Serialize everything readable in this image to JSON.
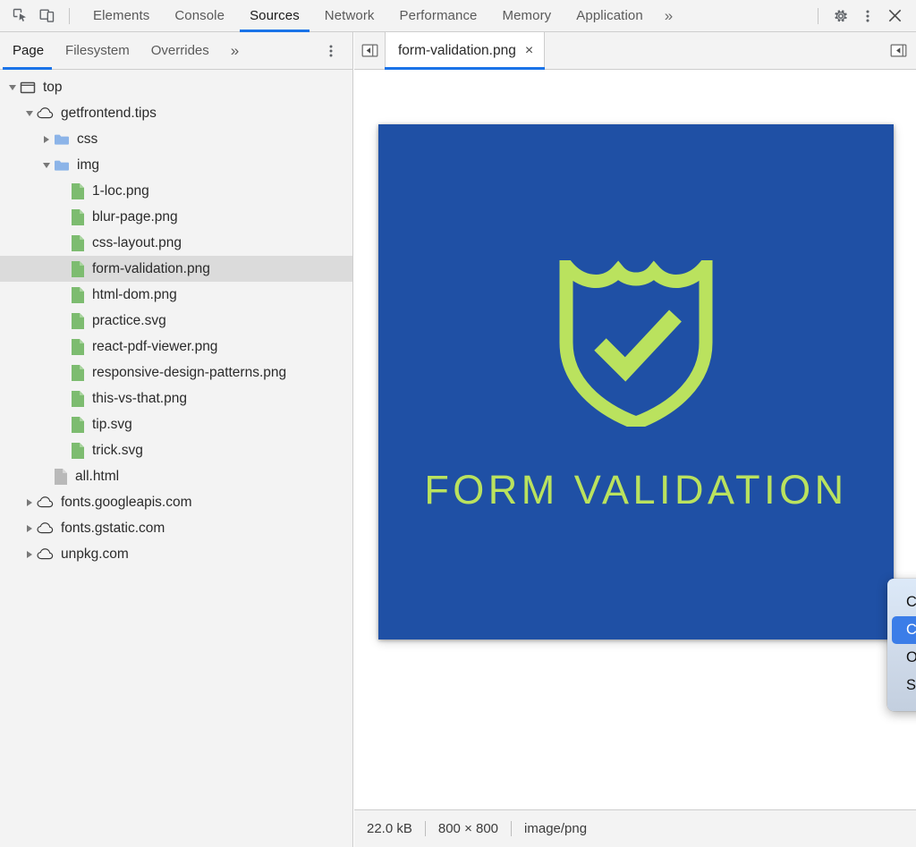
{
  "toolbar": {
    "icons": {
      "inspect": "inspect-element-icon",
      "device": "device-toolbar-icon",
      "more_panels": "»",
      "settings": "gear-icon",
      "kebab": "more-options-icon",
      "close": "close-icon"
    },
    "panels": [
      {
        "label": "Elements",
        "active": false
      },
      {
        "label": "Console",
        "active": false
      },
      {
        "label": "Sources",
        "active": true
      },
      {
        "label": "Network",
        "active": false
      },
      {
        "label": "Performance",
        "active": false
      },
      {
        "label": "Memory",
        "active": false
      },
      {
        "label": "Application",
        "active": false
      }
    ]
  },
  "navigator": {
    "tabs": [
      {
        "label": "Page",
        "active": true
      },
      {
        "label": "Filesystem",
        "active": false
      },
      {
        "label": "Overrides",
        "active": false
      }
    ],
    "more_label": "»",
    "tree": [
      {
        "label": "top",
        "indent": 0,
        "twisty": "down",
        "icon": "frame-icon",
        "selected": false
      },
      {
        "label": "getfrontend.tips",
        "indent": 1,
        "twisty": "down",
        "icon": "cloud-icon",
        "selected": false
      },
      {
        "label": "css",
        "indent": 2,
        "twisty": "right",
        "icon": "folder-icon",
        "selected": false
      },
      {
        "label": "img",
        "indent": 2,
        "twisty": "down",
        "icon": "folder-icon",
        "selected": false
      },
      {
        "label": "1-loc.png",
        "indent": 3,
        "twisty": "none",
        "icon": "image-file-icon",
        "selected": false
      },
      {
        "label": "blur-page.png",
        "indent": 3,
        "twisty": "none",
        "icon": "image-file-icon",
        "selected": false
      },
      {
        "label": "css-layout.png",
        "indent": 3,
        "twisty": "none",
        "icon": "image-file-icon",
        "selected": false
      },
      {
        "label": "form-validation.png",
        "indent": 3,
        "twisty": "none",
        "icon": "image-file-icon",
        "selected": true
      },
      {
        "label": "html-dom.png",
        "indent": 3,
        "twisty": "none",
        "icon": "image-file-icon",
        "selected": false
      },
      {
        "label": "practice.svg",
        "indent": 3,
        "twisty": "none",
        "icon": "image-file-icon",
        "selected": false
      },
      {
        "label": "react-pdf-viewer.png",
        "indent": 3,
        "twisty": "none",
        "icon": "image-file-icon",
        "selected": false
      },
      {
        "label": "responsive-design-patterns.png",
        "indent": 3,
        "twisty": "none",
        "icon": "image-file-icon",
        "selected": false
      },
      {
        "label": "this-vs-that.png",
        "indent": 3,
        "twisty": "none",
        "icon": "image-file-icon",
        "selected": false
      },
      {
        "label": "tip.svg",
        "indent": 3,
        "twisty": "none",
        "icon": "image-file-icon",
        "selected": false
      },
      {
        "label": "trick.svg",
        "indent": 3,
        "twisty": "none",
        "icon": "image-file-icon",
        "selected": false
      },
      {
        "label": "all.html",
        "indent": 2,
        "twisty": "none",
        "icon": "document-file-icon",
        "selected": false
      },
      {
        "label": "fonts.googleapis.com",
        "indent": 1,
        "twisty": "right",
        "icon": "cloud-icon",
        "selected": false
      },
      {
        "label": "fonts.gstatic.com",
        "indent": 1,
        "twisty": "right",
        "icon": "cloud-icon",
        "selected": false
      },
      {
        "label": "unpkg.com",
        "indent": 1,
        "twisty": "right",
        "icon": "cloud-icon",
        "selected": false
      }
    ]
  },
  "editor": {
    "tab": {
      "title": "form-validation.png",
      "close_label": "×"
    },
    "show_navigator_icon": "show-navigator-icon",
    "collapse_sidebar_icon": "collapse-sidebar-icon"
  },
  "preview": {
    "background_color": "#1f50a5",
    "accent_color": "#bae25e",
    "title": "FORM VALIDATION",
    "icon": "shield-check-icon"
  },
  "status": {
    "size": "22.0 kB",
    "dimensions": "800 × 800",
    "mime": "image/png"
  },
  "context_menu": {
    "items": [
      {
        "label": "Copy image URL",
        "highlighted": false
      },
      {
        "label": "Copy image as data URI",
        "highlighted": true
      },
      {
        "label": "Open image in new tab",
        "highlighted": false
      },
      {
        "label": "Save image as…",
        "highlighted": false
      }
    ],
    "highlight_color": "#3b7de8"
  }
}
